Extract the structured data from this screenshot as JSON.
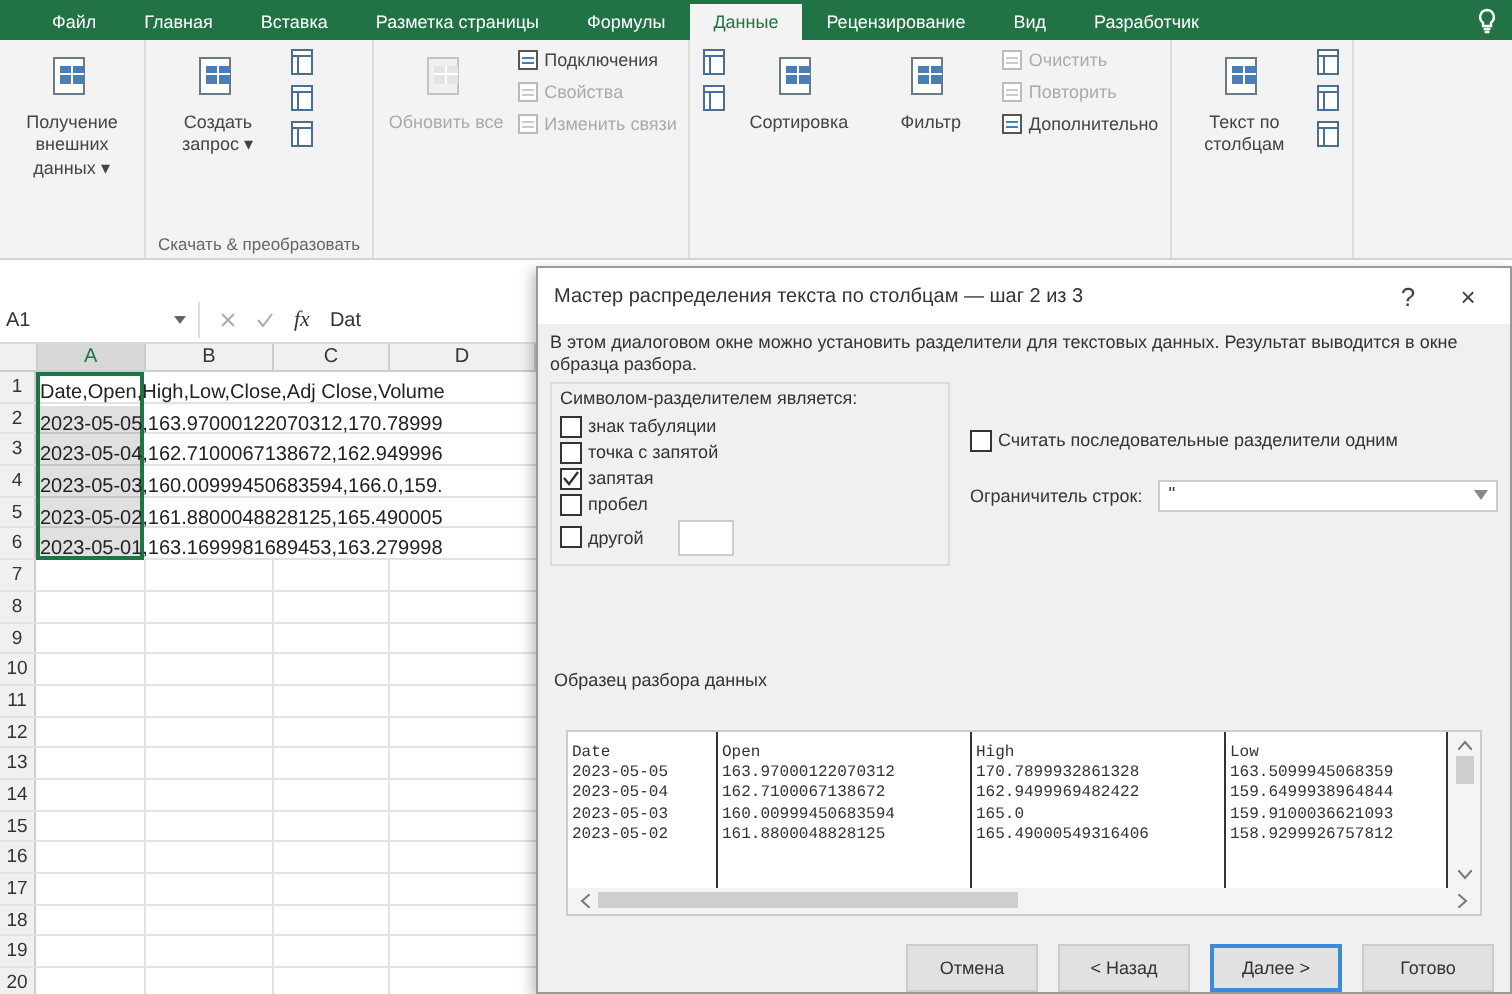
{
  "ribbon_tabs": [
    {
      "label": "Файл",
      "selected": false
    },
    {
      "label": "Главная",
      "selected": false
    },
    {
      "label": "Вставка",
      "selected": false
    },
    {
      "label": "Разметка страницы",
      "selected": false
    },
    {
      "label": "Формулы",
      "selected": false
    },
    {
      "label": "Данные",
      "selected": true
    },
    {
      "label": "Рецензирование",
      "selected": false
    },
    {
      "label": "Вид",
      "selected": false
    },
    {
      "label": "Разработчик",
      "selected": false
    }
  ],
  "ribbon_groups": [
    {
      "columns": [
        [
          {
            "kind": "large",
            "label": "Получение внешних данных ▾",
            "disabled": false
          }
        ]
      ]
    },
    {
      "label": "Скачать & преобразовать",
      "columns": [
        [
          {
            "kind": "large",
            "label": "Создать запрос ▾",
            "disabled": false
          }
        ],
        [
          {
            "kind": "icon"
          },
          {
            "kind": "icon"
          },
          {
            "kind": "icon"
          }
        ]
      ]
    },
    {
      "columns": [
        [
          {
            "kind": "large",
            "label": "Обновить все",
            "disabled": true
          }
        ],
        [
          {
            "kind": "small",
            "label": "Подключения",
            "disabled": false
          },
          {
            "kind": "small",
            "label": "Свойства",
            "disabled": true
          },
          {
            "kind": "small",
            "label": "Изменить связи",
            "disabled": true
          }
        ]
      ]
    },
    {
      "columns": [
        [
          {
            "kind": "icon"
          },
          {
            "kind": "icon"
          }
        ],
        [
          {
            "kind": "large",
            "label": "Сортировка",
            "disabled": false
          }
        ],
        [
          {
            "kind": "large",
            "label": "Фильтр",
            "disabled": false
          }
        ],
        [
          {
            "kind": "small",
            "label": "Очистить",
            "disabled": true
          },
          {
            "kind": "small",
            "label": "Повторить",
            "disabled": true
          },
          {
            "kind": "small",
            "label": "Дополнительно",
            "disabled": false
          }
        ]
      ]
    },
    {
      "columns": [
        [
          {
            "kind": "large",
            "label": "Текст по столбцам",
            "disabled": false
          }
        ],
        [
          {
            "kind": "icon"
          },
          {
            "kind": "icon"
          },
          {
            "kind": "icon"
          }
        ]
      ]
    }
  ],
  "formula_bar": {
    "name_box": "A1",
    "function_symbol": "fx",
    "value": "Dat"
  },
  "sheet": {
    "columns": [
      "A",
      "B",
      "C",
      "D"
    ],
    "rows": [
      {
        "number": "1",
        "text": "Date,Open,High,Low,Close,Adj Close,Volume"
      },
      {
        "number": "2",
        "text": "2023-05-05,163.97000122070312,170.78999"
      },
      {
        "number": "3",
        "text": "2023-05-04,162.7100067138672,162.949996"
      },
      {
        "number": "4",
        "text": "2023-05-03,160.00999450683594,166.0,159."
      },
      {
        "number": "5",
        "text": "2023-05-02,161.8800048828125,165.490005"
      },
      {
        "number": "6",
        "text": "2023-05-01,163.1699981689453,163.279998"
      },
      {
        "number": "7",
        "text": ""
      },
      {
        "number": "8",
        "text": ""
      },
      {
        "number": "9",
        "text": ""
      },
      {
        "number": "10",
        "text": ""
      },
      {
        "number": "11",
        "text": ""
      },
      {
        "number": "12",
        "text": ""
      },
      {
        "number": "13",
        "text": ""
      },
      {
        "number": "14",
        "text": ""
      },
      {
        "number": "15",
        "text": ""
      },
      {
        "number": "16",
        "text": ""
      },
      {
        "number": "17",
        "text": ""
      },
      {
        "number": "18",
        "text": ""
      },
      {
        "number": "19",
        "text": ""
      },
      {
        "number": "20",
        "text": ""
      }
    ]
  },
  "dialog": {
    "title": "Мастер распределения текста по столбцам — шаг 2 из 3",
    "help": "?",
    "close": "×",
    "description": "В этом диалоговом окне можно установить разделители для текстовых данных. Результат выводится в окне образца разбора.",
    "delimiters_label": "Символом-разделителем является:",
    "delimiters": [
      {
        "label": "знак табуляции",
        "checked": false
      },
      {
        "label": "точка с запятой",
        "checked": false
      },
      {
        "label": "запятая",
        "checked": true
      },
      {
        "label": "пробел",
        "checked": false
      },
      {
        "label": "другой",
        "checked": false
      }
    ],
    "consecutive": {
      "label": "Считать последовательные разделители одним",
      "checked": false
    },
    "qualifier": {
      "label": "Ограничитель строк:",
      "value": "\""
    },
    "preview_label": "Образец разбора данных",
    "preview": [
      [
        "Date",
        "Open",
        "High",
        "Low"
      ],
      [
        "2023-05-05",
        "163.97000122070312",
        "170.7899932861328",
        "163.5099945068359"
      ],
      [
        "2023-05-04",
        "162.7100067138672",
        "162.9499969482422",
        "159.6499938964844"
      ],
      [
        "2023-05-03",
        "160.00999450683594",
        "165.0",
        "159.9100036621093"
      ],
      [
        "2023-05-02",
        "161.8800048828125",
        "165.49000549316406",
        "158.9299926757812"
      ]
    ],
    "buttons": [
      {
        "label": "Отмена",
        "default": false
      },
      {
        "label": "< Назад",
        "default": false
      },
      {
        "label": "Далее >",
        "default": true
      },
      {
        "label": "Готово",
        "default": false
      }
    ]
  }
}
